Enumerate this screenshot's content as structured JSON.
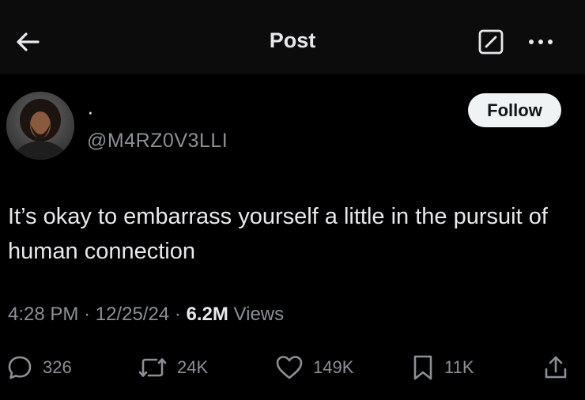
{
  "header": {
    "title": "Post",
    "icons": {
      "back": "arrow-left-icon",
      "compose": "compose-icon",
      "more": "more-dots-icon"
    }
  },
  "author": {
    "display_name": "·",
    "handle": "@M4RZ0V3LLI",
    "follow_label": "Follow"
  },
  "post": {
    "text": "It’s okay to embarrass yourself a little in the pursuit of human connection",
    "time": "4:28 PM",
    "date": "12/25/24",
    "views_count": "6.2M",
    "views_label": "Views"
  },
  "actions": {
    "reply_count": "326",
    "repost_count": "24K",
    "like_count": "149K",
    "bookmark_count": "11K"
  },
  "colors": {
    "background": "#000000",
    "header": "#0c0c0c",
    "text": "#e7e9ea",
    "muted": "#8b9096",
    "follow_bg": "#eff3f4"
  }
}
